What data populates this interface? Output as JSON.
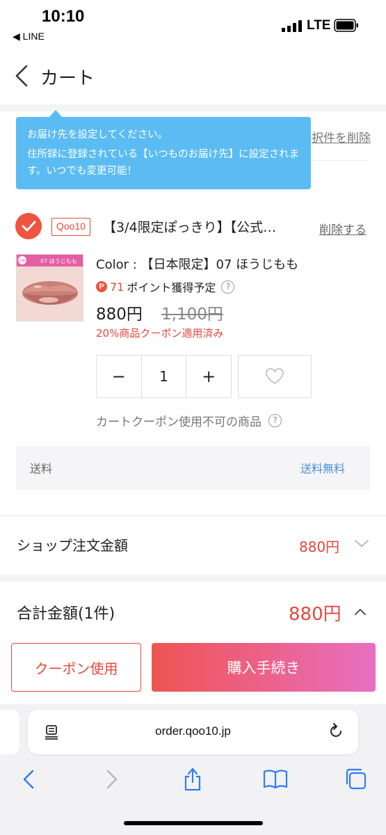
{
  "status_bar": {
    "time": "10:10",
    "back_app": "◀ LINE",
    "network": "LTE"
  },
  "header": {
    "title": "カート"
  },
  "cart_actions": {
    "delete_selected": "択件を削除"
  },
  "tooltip": {
    "title": "お届け先を設定してください。",
    "body": "住所録に登録されている【いつものお届け先】に設定されます。いつでも変更可能！"
  },
  "item": {
    "shop_badge": "Qoo10",
    "name": "【3/4限定ぽっきり】【公式…",
    "delete_label": "削除する",
    "thumb_label": "07 ほうじもも",
    "thumb_tag": "日本限定",
    "option": "Color : 【日本限定】07 ほうじもも",
    "points_icon": "P",
    "points_value": "71",
    "points_label": "ポイント獲得予定",
    "help_icon": "?",
    "price": "880円",
    "price_original": "1,100円",
    "coupon_applied": "20%商品クーポン適用済み",
    "quantity": "1",
    "minus": "−",
    "plus": "+",
    "cart_coupon_note": "カートクーポン使用不可の商品"
  },
  "shipping": {
    "label": "送料",
    "value": "送料無料"
  },
  "summary": {
    "shop_total_label": "ショップ注文金額",
    "shop_total_value": "880円",
    "total_label": "合計金額(1件)",
    "total_value": "880円"
  },
  "buttons": {
    "coupon": "クーポン使用",
    "checkout": "購入手続き"
  },
  "browser": {
    "url": "order.qoo10.jp"
  },
  "colors": {
    "accent": "#e7473b",
    "tooltip": "#5bbcf3",
    "link": "#4a90d9"
  }
}
